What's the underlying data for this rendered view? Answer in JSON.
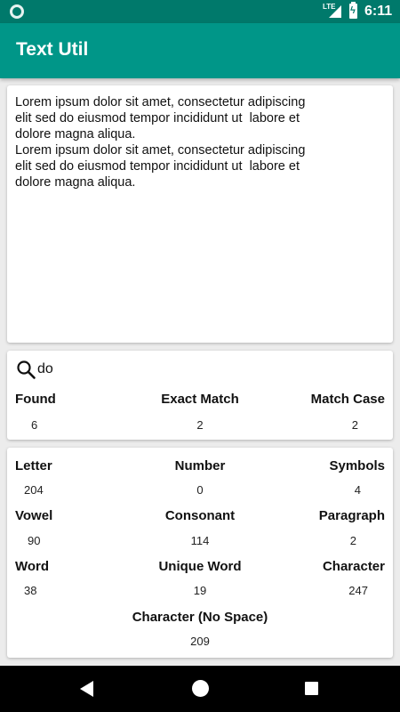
{
  "status_bar": {
    "network": "LTE",
    "time": "6:11"
  },
  "app_bar": {
    "title": "Text Util"
  },
  "editor": {
    "text": "Lorem ipsum dolor sit amet, consectetur adipiscing\nelit sed do eiusmod tempor incididunt ut  labore et\ndolore magna aliqua.\nLorem ipsum dolor sit amet, consectetur adipiscing\nelit sed do eiusmod tempor incididunt ut  labore et\ndolore magna aliqua."
  },
  "search": {
    "icon": "search-icon",
    "query": "do",
    "found_label": "Found",
    "found_value": "6",
    "exact_label": "Exact Match",
    "exact_value": "2",
    "case_label": "Match Case",
    "case_value": "2"
  },
  "stats": {
    "letter_label": "Letter",
    "letter_value": "204",
    "number_label": "Number",
    "number_value": "0",
    "symbols_label": "Symbols",
    "symbols_value": "4",
    "vowel_label": "Vowel",
    "vowel_value": "90",
    "consonant_label": "Consonant",
    "consonant_value": "114",
    "paragraph_label": "Paragraph",
    "paragraph_value": "2",
    "word_label": "Word",
    "word_value": "38",
    "unique_word_label": "Unique Word",
    "unique_word_value": "19",
    "character_label": "Character",
    "character_value": "247",
    "char_nospace_label": "Character (No Space)",
    "char_nospace_value": "209"
  },
  "nav_bar": {
    "back_icon": "back-triangle-icon",
    "home_icon": "home-circle-icon",
    "recents_icon": "recents-square-icon"
  },
  "colors": {
    "status_bar": "#00796b",
    "app_bar": "#009688",
    "background": "#ececec",
    "card": "#ffffff"
  }
}
